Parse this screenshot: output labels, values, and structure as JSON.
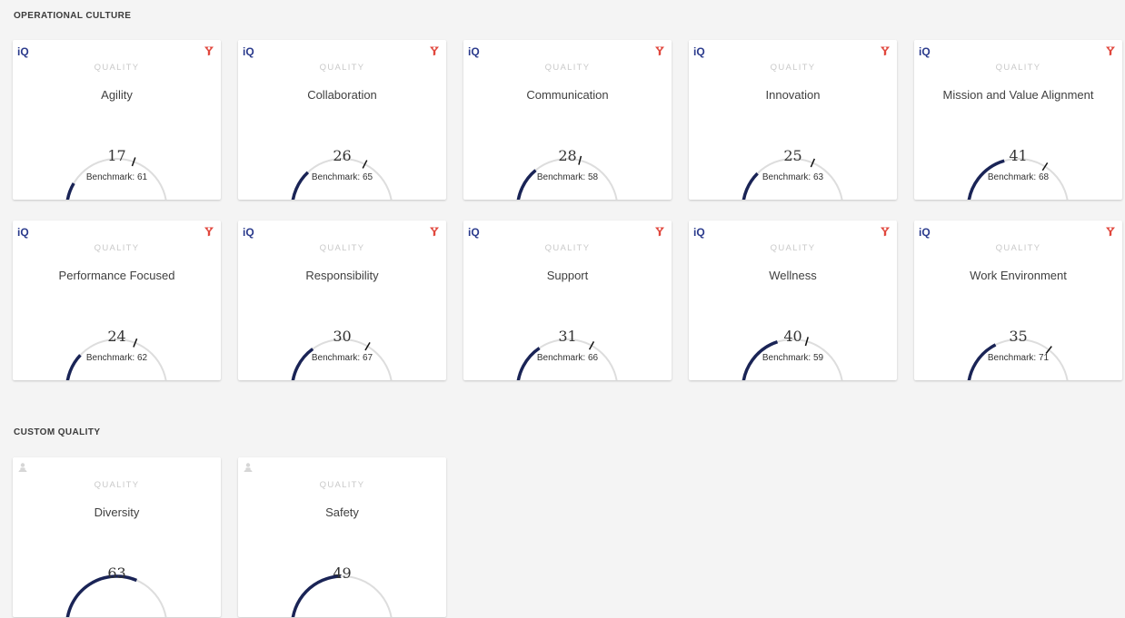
{
  "colors": {
    "accent": "#1a2456",
    "track": "#dddddd",
    "filter": "#e0463c",
    "brand": "#2a3a8c",
    "muted": "#c9c9c9"
  },
  "sections": [
    {
      "title": "OPERATIONAL CULTURE",
      "cards": [
        {
          "brand": "iQ",
          "caption": "QUALITY",
          "name": "Agility",
          "value": 17,
          "benchmark": 61,
          "benchmark_label": "Benchmark: 61",
          "icon": "filter-icon"
        },
        {
          "brand": "iQ",
          "caption": "QUALITY",
          "name": "Collaboration",
          "value": 26,
          "benchmark": 65,
          "benchmark_label": "Benchmark: 65",
          "icon": "filter-icon"
        },
        {
          "brand": "iQ",
          "caption": "QUALITY",
          "name": "Communication",
          "value": 28,
          "benchmark": 58,
          "benchmark_label": "Benchmark: 58",
          "icon": "filter-icon"
        },
        {
          "brand": "iQ",
          "caption": "QUALITY",
          "name": "Innovation",
          "value": 25,
          "benchmark": 63,
          "benchmark_label": "Benchmark: 63",
          "icon": "filter-icon"
        },
        {
          "brand": "iQ",
          "caption": "QUALITY",
          "name": "Mission and Value Alignment",
          "value": 41,
          "benchmark": 68,
          "benchmark_label": "Benchmark: 68",
          "icon": "filter-icon"
        },
        {
          "brand": "iQ",
          "caption": "QUALITY",
          "name": "Performance Focused",
          "value": 24,
          "benchmark": 62,
          "benchmark_label": "Benchmark: 62",
          "icon": "filter-icon"
        },
        {
          "brand": "iQ",
          "caption": "QUALITY",
          "name": "Responsibility",
          "value": 30,
          "benchmark": 67,
          "benchmark_label": "Benchmark: 67",
          "icon": "filter-icon"
        },
        {
          "brand": "iQ",
          "caption": "QUALITY",
          "name": "Support",
          "value": 31,
          "benchmark": 66,
          "benchmark_label": "Benchmark: 66",
          "icon": "filter-icon"
        },
        {
          "brand": "iQ",
          "caption": "QUALITY",
          "name": "Wellness",
          "value": 40,
          "benchmark": 59,
          "benchmark_label": "Benchmark: 59",
          "icon": "filter-icon"
        },
        {
          "brand": "iQ",
          "caption": "QUALITY",
          "name": "Work Environment",
          "value": 35,
          "benchmark": 71,
          "benchmark_label": "Benchmark: 71",
          "icon": "filter-icon"
        }
      ]
    },
    {
      "title": "CUSTOM QUALITY",
      "cards": [
        {
          "caption": "QUALITY",
          "name": "Diversity",
          "value": 63,
          "icon": "team-icon"
        },
        {
          "caption": "QUALITY",
          "name": "Safety",
          "value": 49,
          "icon": "team-icon"
        }
      ]
    }
  ]
}
